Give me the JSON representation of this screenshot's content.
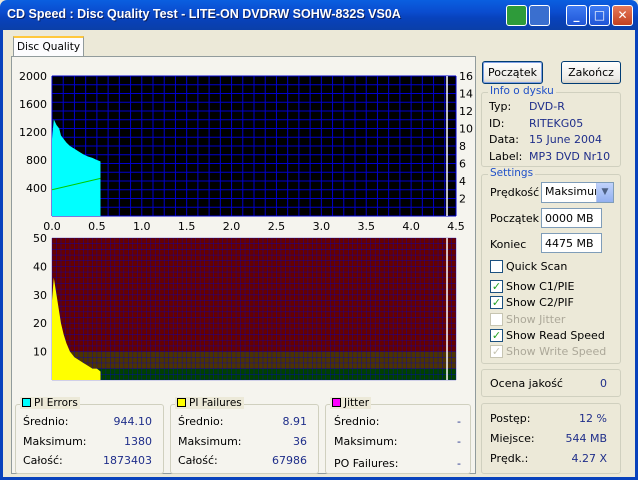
{
  "window": {
    "title": "CD Speed : Disc Quality Test - LITE-ON DVDRW SOHW-832S  VS0A"
  },
  "tab": {
    "label": "Disc Quality"
  },
  "buttons": {
    "start": "Początek",
    "end": "Zakończ"
  },
  "disc_info": {
    "title": "Info o dysku",
    "labels": [
      "Typ:",
      "ID:",
      "Data:",
      "Label:"
    ],
    "values": [
      "DVD-R",
      "RITEKG05",
      "15 June 2004",
      "MP3 DVD Nr10"
    ]
  },
  "settings": {
    "title": "Settings",
    "speed_label": "Prędkość",
    "speed_value": "Maksimum",
    "start_label": "Początek",
    "start_value": "0000 MB",
    "end_label": "Koniec",
    "end_value": "4475 MB",
    "checkboxes": [
      {
        "label": "Quick Scan",
        "checked": false,
        "disabled": false
      },
      {
        "label": "Show C1/PIE",
        "checked": true,
        "disabled": false
      },
      {
        "label": "Show C2/PIF",
        "checked": true,
        "disabled": false
      },
      {
        "label": "Show Jitter",
        "checked": false,
        "disabled": true
      },
      {
        "label": "Show Read Speed",
        "checked": true,
        "disabled": false
      },
      {
        "label": "Show Write Speed",
        "checked": true,
        "disabled": true
      }
    ]
  },
  "quality": {
    "label": "Ocena jakość",
    "value": "0"
  },
  "progress": {
    "labels": [
      "Postęp:",
      "Miejsce:",
      "Prędk.:"
    ],
    "values": [
      "12 %",
      "544 MB",
      "4.27 X"
    ]
  },
  "pi_errors": {
    "title": "PI Errors",
    "color": "#00FFFF",
    "labels": [
      "Średnio:",
      "Maksimum:",
      "Całość:"
    ],
    "values": [
      "944.10",
      "1380",
      "1873403"
    ]
  },
  "pi_failures": {
    "title": "PI Failures",
    "color": "#FFFF00",
    "labels": [
      "Średnio:",
      "Maksimum:",
      "Całość:"
    ],
    "values": [
      "8.91",
      "36",
      "67986"
    ]
  },
  "jitter": {
    "title": "Jitter",
    "color": "#FF00FF",
    "labels": [
      "Średnio:",
      "Maksimum:"
    ],
    "values": [
      "-",
      "-"
    ],
    "po_label": "PO Failures:",
    "po_value": "-"
  },
  "colors": {
    "top_bg": "#000000",
    "grid": "#0000CC",
    "pie_fill": "#00FFFF",
    "speed_line": "#00CC00",
    "bottom_bg": "#660000",
    "pif_fill": "#FFFF00",
    "band_mid": "#4D3300",
    "band_low": "#004000",
    "marker": "#FFFFFF"
  },
  "chart_data": [
    {
      "type": "area",
      "name": "PI Errors / Read Speed",
      "x_ticks": [
        "0.0",
        "0.5",
        "1.0",
        "1.5",
        "2.0",
        "2.5",
        "3.0",
        "3.5",
        "4.0",
        "4.5"
      ],
      "y_left_ticks": [
        "2000",
        "1600",
        "1200",
        "800",
        "400"
      ],
      "y_right_ticks": [
        "16",
        "14",
        "12",
        "10",
        "8",
        "6",
        "4",
        "2"
      ],
      "xlim": [
        0,
        4.5
      ],
      "ylim": [
        0,
        2000
      ],
      "y2lim": [
        0,
        16
      ],
      "marker_x": 4.4,
      "series": [
        {
          "name": "PI Errors",
          "x": [
            0.0,
            0.02,
            0.05,
            0.08,
            0.1,
            0.13,
            0.16,
            0.2,
            0.25,
            0.3,
            0.35,
            0.4,
            0.45,
            0.5,
            0.54
          ],
          "values": [
            1100,
            1380,
            1300,
            1250,
            1150,
            1100,
            1050,
            1000,
            960,
            920,
            880,
            850,
            830,
            800,
            780
          ]
        },
        {
          "name": "Read Speed",
          "x": [
            0.0,
            0.54
          ],
          "values": [
            3.0,
            4.3
          ]
        }
      ]
    },
    {
      "type": "area",
      "name": "PI Failures",
      "x_ticks": [
        "0.0",
        "0.5",
        "1.0",
        "1.5",
        "2.0",
        "2.5",
        "3.0",
        "3.5",
        "4.0",
        "4.5"
      ],
      "y_ticks": [
        "50",
        "40",
        "30",
        "20",
        "10"
      ],
      "xlim": [
        0,
        4.5
      ],
      "ylim": [
        0,
        50
      ],
      "marker_x": 4.4,
      "series": [
        {
          "name": "PI Failures",
          "x": [
            0.0,
            0.02,
            0.05,
            0.08,
            0.1,
            0.13,
            0.16,
            0.2,
            0.25,
            0.3,
            0.35,
            0.4,
            0.45,
            0.5,
            0.54
          ],
          "values": [
            28,
            36,
            30,
            24,
            20,
            16,
            13,
            10,
            8,
            7,
            6,
            5,
            4,
            4,
            3
          ]
        }
      ]
    }
  ]
}
